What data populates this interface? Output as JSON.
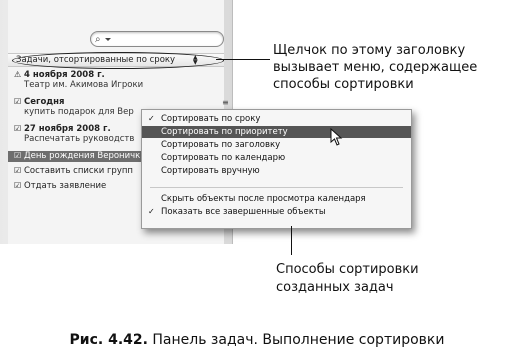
{
  "search": {
    "icon": "search-icon",
    "value": ""
  },
  "header": {
    "sort_label": "Задачи, отсортированные по сроку"
  },
  "tasks": [
    {
      "kind": "date",
      "icon": "warning-icon",
      "text": "4 ноября 2008 г."
    },
    {
      "kind": "sub",
      "text": "Театр им. Акимова Игроки"
    },
    {
      "kind": "date",
      "icon": "checkbox-icon",
      "text": "Сегодня"
    },
    {
      "kind": "sub",
      "text": "купить подарок для Вер"
    },
    {
      "kind": "date",
      "icon": "checkbox-icon",
      "text": "27 ноября 2008 г."
    },
    {
      "kind": "sub",
      "text": "Распечатать руководств"
    },
    {
      "kind": "selected",
      "icon": "checkbox-icon",
      "text": "День рождения Вероничк"
    },
    {
      "kind": "item",
      "icon": "checkbox-icon",
      "text": "Составить списки групп"
    },
    {
      "kind": "item",
      "icon": "checkbox-icon",
      "text": "Отдать заявление"
    }
  ],
  "menu": {
    "items": [
      {
        "label": "Сортировать по сроку",
        "checked": true,
        "highlighted": false
      },
      {
        "label": "Сортировать по приоритету",
        "checked": false,
        "highlighted": true
      },
      {
        "label": "Сортировать по заголовку",
        "checked": false,
        "highlighted": false
      },
      {
        "label": "Сортировать по календарю",
        "checked": false,
        "highlighted": false
      },
      {
        "label": "Сортировать вручную",
        "checked": false,
        "highlighted": false
      },
      {
        "label": "Скрыть объекты после просмотра календаря",
        "checked": false,
        "highlighted": false
      },
      {
        "label": "Показать все завершенные объекты",
        "checked": true,
        "highlighted": false
      }
    ]
  },
  "callouts": {
    "top": [
      "Щелчок по этому заголовку",
      "вызывает меню, содержащее",
      "способы сортировки"
    ],
    "bottom": [
      "Способы сортировки",
      "созданных задач"
    ]
  },
  "caption": {
    "number": "Рис. 4.42.",
    "text": "Панель задач. Выполнение сортировки"
  },
  "colors": {
    "highlight": "#555555",
    "selection": "#6e6e6e"
  }
}
